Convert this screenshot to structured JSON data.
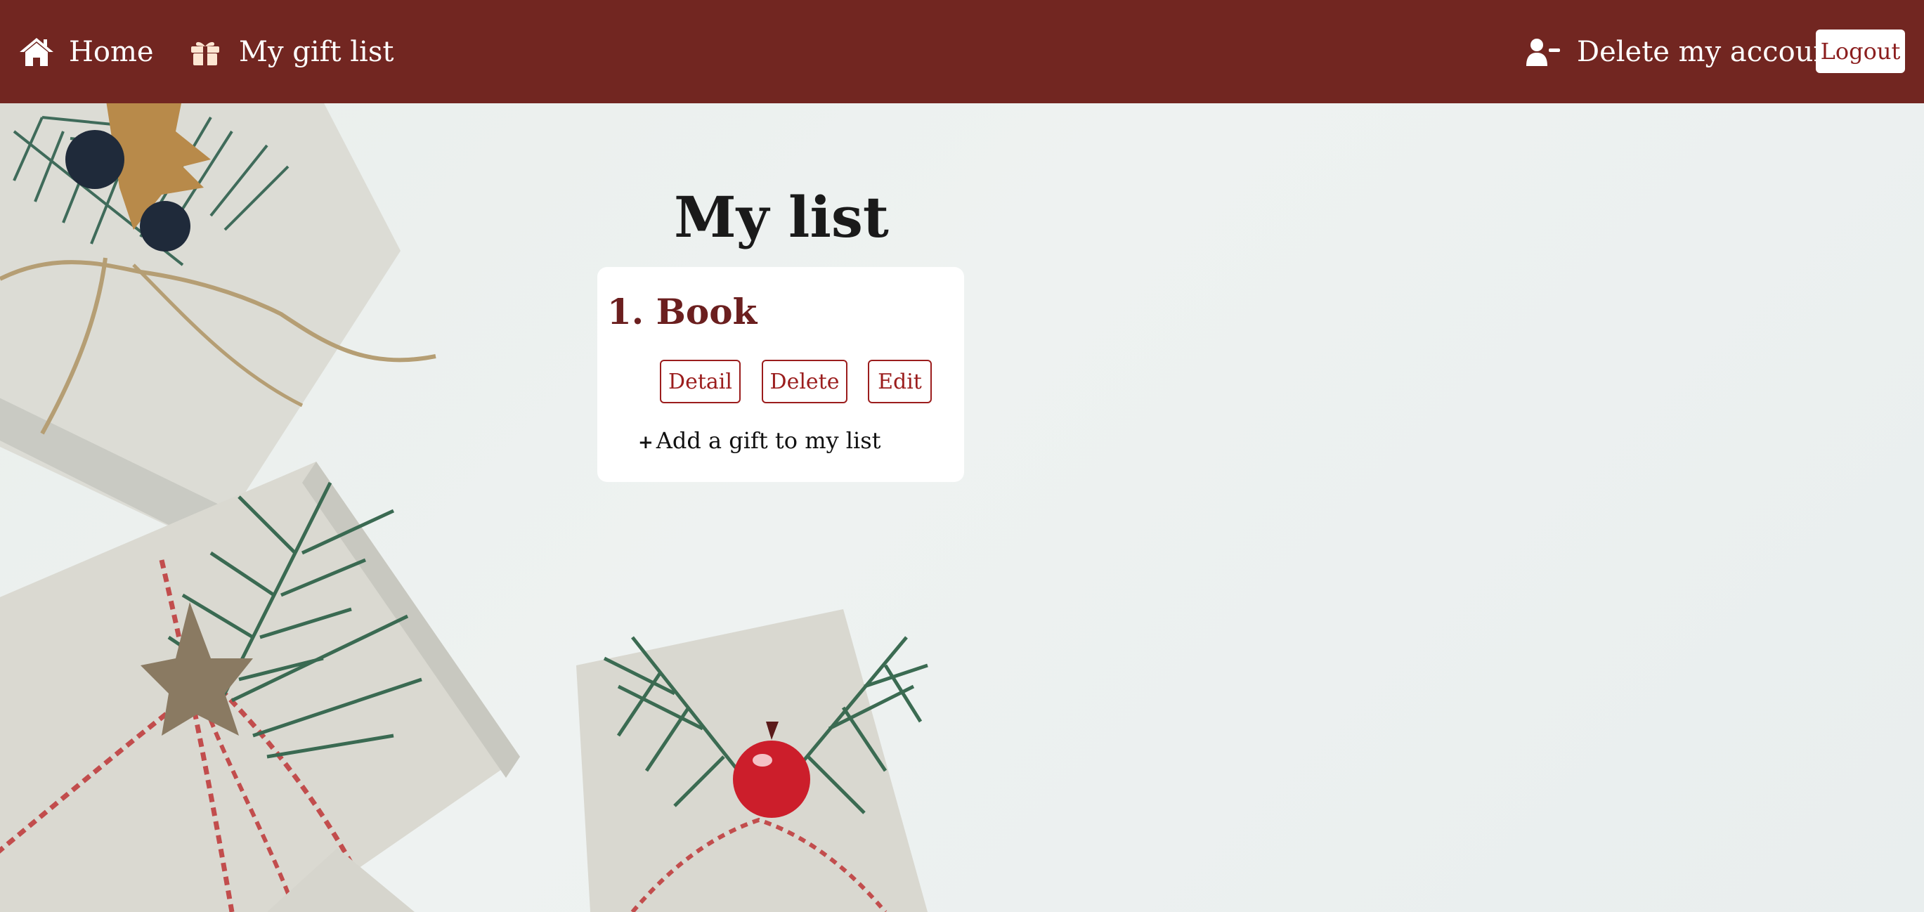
{
  "nav": {
    "home_label": "Home",
    "gifts_label": "My gift list",
    "delete_account_label": "Delete my account",
    "logout_label": "Logout"
  },
  "main": {
    "title": "My list",
    "items": [
      {
        "label": "1. Book",
        "detail_label": "Detail",
        "delete_label": "Delete",
        "edit_label": "Edit"
      }
    ],
    "add_label": "Add a gift to my list",
    "add_icon": "+"
  },
  "colors": {
    "navbar": "#722621",
    "accent": "#9b1d1d",
    "item_title": "#6b1f1f"
  }
}
